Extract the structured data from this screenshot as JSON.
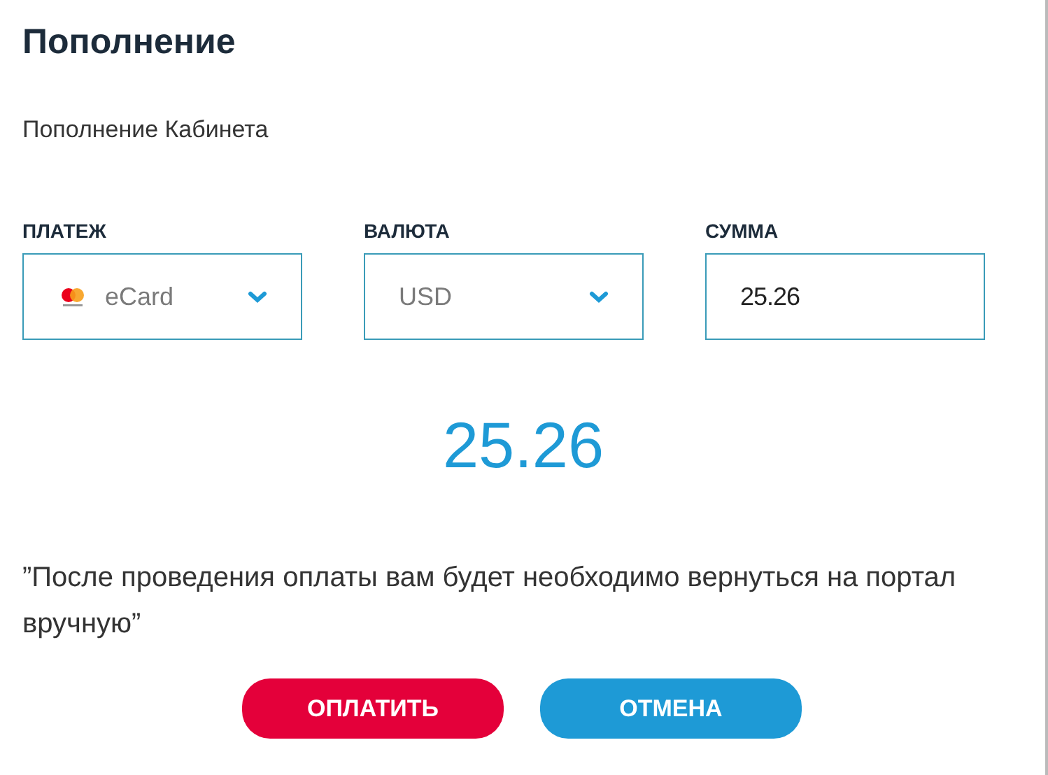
{
  "title": "Пополнение",
  "subtitle": "Пополнение Кабинета",
  "fields": [
    {
      "label": "ПЛАТЕЖ",
      "kind": "select",
      "value": "eCard",
      "icon": true
    },
    {
      "label": "ВАЛЮТА",
      "kind": "select",
      "value": "USD",
      "icon": false
    },
    {
      "label": "СУММА",
      "kind": "input",
      "value": "25.26"
    }
  ],
  "total": "25.26",
  "note": "”После проведения оплаты вам будет необходимо вернуться на портал вручную”",
  "buttons": [
    {
      "label": "ОПЛАТИТЬ",
      "kind": "primary"
    },
    {
      "label": "ОТМЕНА",
      "kind": "secondary"
    }
  ]
}
